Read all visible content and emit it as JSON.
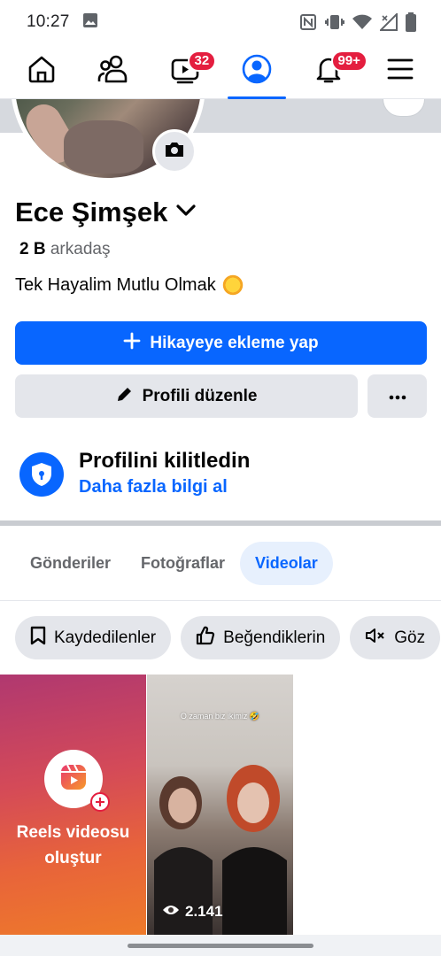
{
  "status_bar": {
    "time": "10:27",
    "icons": [
      "gallery-icon",
      "nfc-icon",
      "vibrate-icon",
      "wifi-icon",
      "signal-icon",
      "battery-icon"
    ]
  },
  "navbar": {
    "items": [
      {
        "name": "home",
        "icon": "home-icon"
      },
      {
        "name": "friends",
        "icon": "friends-icon"
      },
      {
        "name": "video",
        "icon": "video-icon",
        "badge": "32"
      },
      {
        "name": "profile",
        "icon": "profile-icon",
        "active": true
      },
      {
        "name": "notifications",
        "icon": "bell-icon",
        "badge": "99+"
      },
      {
        "name": "menu",
        "icon": "menu-icon"
      }
    ]
  },
  "profile": {
    "name": "Ece Şimşek",
    "friends_count": "2 B",
    "friends_label": "arkadaş",
    "bio": "Tek Hayalim Mutlu Olmak"
  },
  "actions": {
    "add_story": "Hikayeye ekleme yap",
    "edit_profile": "Profili düzenle"
  },
  "lock_notice": {
    "title": "Profilini kilitledin",
    "link": "Daha fazla bilgi al"
  },
  "tabs": [
    {
      "label": "Gönderiler",
      "active": false
    },
    {
      "label": "Fotoğraflar",
      "active": false
    },
    {
      "label": "Videolar",
      "active": true
    }
  ],
  "chips": [
    {
      "label": "Kaydedilenler",
      "icon": "bookmark-icon"
    },
    {
      "label": "Beğendiklerin",
      "icon": "thumbs-up-icon"
    },
    {
      "label": "Göz",
      "icon": "mute-icon"
    }
  ],
  "videos": {
    "create_reels": "Reels videosu oluştur",
    "first_video": {
      "caption": "O zaman biz ikimiz 🤣",
      "views": "2.141"
    }
  },
  "colors": {
    "accent": "#0866ff",
    "badge": "#e41e3f"
  }
}
